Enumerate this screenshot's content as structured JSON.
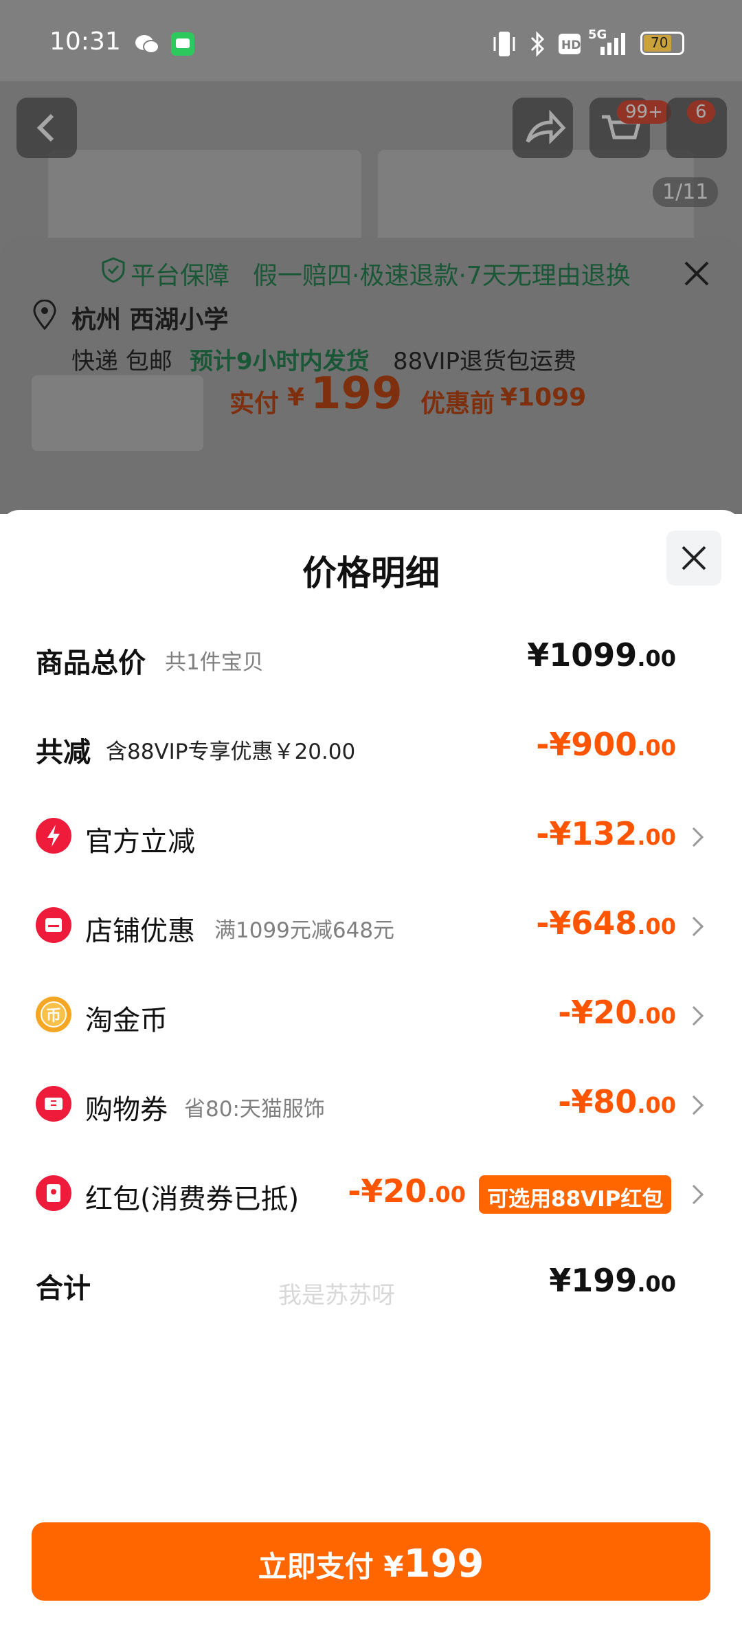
{
  "status_bar": {
    "time": "10:31",
    "network": "5G",
    "battery": "70",
    "icons": [
      "wechat-icon",
      "message-icon",
      "vibrate-icon",
      "bluetooth-icon",
      "hd-icon",
      "signal-icon",
      "battery-icon"
    ]
  },
  "background": {
    "cart_badge": "99+",
    "msg_badge": "6",
    "photo_counter": "1/11",
    "guarantee_title": "平台保障",
    "guarantee_text": "假一赔四·极速退款·7天无理由退换",
    "location": "杭州 西湖小学",
    "delivery_type": "快递 包邮",
    "ship_time": "预计9小时内发货",
    "vip_return": "88VIP退货包运费",
    "paid_label": "实付",
    "paid_price": "199",
    "before_label": "优惠前",
    "before_price": "¥1099"
  },
  "sheet": {
    "title": "价格明细",
    "watermark": "我是苏苏呀",
    "rows": [
      {
        "label": "商品总价",
        "sub": "共1件宝贝",
        "amount_int": "¥1099",
        "amount_dec": ".00"
      },
      {
        "label": "共减",
        "sub": "含88VIP专享优惠￥20.00",
        "amount_int": "-¥900",
        "amount_dec": ".00"
      },
      {
        "label": "官方立减",
        "sub": "",
        "amount_int": "-¥132",
        "amount_dec": ".00",
        "icon": "lightning-icon"
      },
      {
        "label": "店铺优惠",
        "sub": "满1099元减648元",
        "amount_int": "-¥648",
        "amount_dec": ".00",
        "icon": "store-icon"
      },
      {
        "label": "淘金币",
        "sub": "",
        "amount_int": "-¥20",
        "amount_dec": ".00",
        "icon": "gold-coin-icon"
      },
      {
        "label": "购物券",
        "sub": "省80:天猫服饰",
        "amount_int": "-¥80",
        "amount_dec": ".00",
        "icon": "voucher-icon"
      },
      {
        "label": "红包(消费券已抵)",
        "sub": "",
        "amount_int": "-¥20",
        "amount_dec": ".00",
        "icon": "red-packet-icon",
        "tag": "可选用88VIP红包"
      },
      {
        "label": "合计",
        "sub": "",
        "amount_int": "¥199",
        "amount_dec": ".00"
      }
    ],
    "pay_button": {
      "label": "立即支付",
      "currency": "¥",
      "price": "199"
    }
  },
  "colors": {
    "accent": "#ff6600",
    "amount_orange": "#ff5500",
    "icon_red": "#ee1c3a",
    "coin_gold": "#f5a623",
    "guarantee_green": "#1f8f54"
  }
}
